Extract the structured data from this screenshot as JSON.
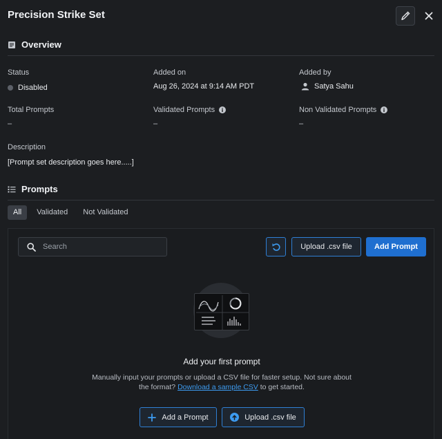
{
  "header": {
    "title": "Precision Strike Set"
  },
  "overview": {
    "heading": "Overview",
    "status": {
      "label": "Status",
      "value": "Disabled"
    },
    "added_on": {
      "label": "Added on",
      "value": "Aug 26, 2024 at 9:14 AM PDT"
    },
    "added_by": {
      "label": "Added by",
      "value": "Satya Sahu"
    },
    "total_prompts": {
      "label": "Total Prompts",
      "value": "–"
    },
    "validated_prompts": {
      "label": "Validated Prompts",
      "value": "–"
    },
    "non_validated_prompts": {
      "label": "Non Validated Prompts",
      "value": "–"
    },
    "description": {
      "label": "Description",
      "value": "[Prompt set description goes here.....]"
    }
  },
  "prompts": {
    "heading": "Prompts",
    "tabs": [
      {
        "label": "All",
        "active": true
      },
      {
        "label": "Validated",
        "active": false
      },
      {
        "label": "Not Validated",
        "active": false
      }
    ],
    "search_placeholder": "Search",
    "upload_button": "Upload .csv file",
    "add_button": "Add Prompt",
    "empty_state": {
      "title": "Add your first prompt",
      "desc_before": "Manually input your prompts or upload a CSV file for faster setup. Not sure about the format?",
      "link": "Download a sample CSV",
      "desc_after": "to get started.",
      "add_button": "Add a Prompt",
      "upload_button": "Upload .csv file"
    }
  },
  "colors": {
    "accent": "#1f6fd0",
    "link": "#3d9bf0",
    "background": "#1c1e21"
  }
}
